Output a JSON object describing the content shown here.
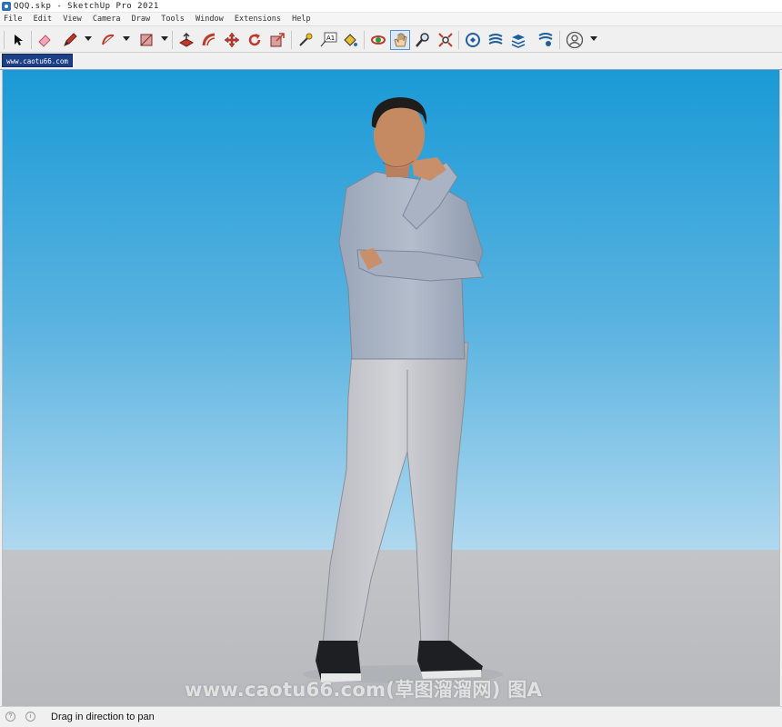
{
  "window": {
    "title": "QQQ.skp - SketchUp Pro 2021"
  },
  "menu": {
    "items": [
      "File",
      "Edit",
      "View",
      "Camera",
      "Draw",
      "Tools",
      "Window",
      "Extensions",
      "Help"
    ]
  },
  "toolbar": {
    "tools": [
      {
        "name": "select-tool",
        "icon": "arrow-cursor-icon"
      },
      {
        "name": "eraser-tool",
        "icon": "eraser-icon"
      },
      {
        "name": "line-tool",
        "icon": "pencil-icon"
      },
      {
        "name": "arc-tool",
        "icon": "arc-icon"
      },
      {
        "name": "shape-tool",
        "icon": "rectangle-icon"
      },
      {
        "name": "push-pull-tool",
        "icon": "push-pull-icon"
      },
      {
        "name": "offset-tool",
        "icon": "offset-icon"
      },
      {
        "name": "move-tool",
        "icon": "move-icon"
      },
      {
        "name": "rotate-tool",
        "icon": "rotate-icon"
      },
      {
        "name": "scale-tool",
        "icon": "scale-icon"
      },
      {
        "name": "tape-measure-tool",
        "icon": "tape-measure-icon"
      },
      {
        "name": "text-tool",
        "icon": "text-icon",
        "label": "A1"
      },
      {
        "name": "paint-bucket-tool",
        "icon": "paint-bucket-icon"
      },
      {
        "name": "orbit-tool",
        "icon": "orbit-icon"
      },
      {
        "name": "pan-tool",
        "icon": "hand-icon",
        "active": true
      },
      {
        "name": "zoom-tool",
        "icon": "magnifier-icon"
      },
      {
        "name": "zoom-extents-tool",
        "icon": "zoom-extents-icon"
      },
      {
        "name": "3d-warehouse",
        "icon": "warehouse-icon"
      },
      {
        "name": "extension-warehouse",
        "icon": "extension-warehouse-icon"
      },
      {
        "name": "layout",
        "icon": "layout-icon"
      },
      {
        "name": "extension-manager",
        "icon": "extension-manager-icon"
      },
      {
        "name": "account",
        "icon": "user-icon"
      }
    ],
    "accent": "#c0392b",
    "active_highlight": "#5a8fd0"
  },
  "scene_tab": {
    "label": "www.caotu66.com"
  },
  "viewport": {
    "sky_top": "#1a9ad6",
    "sky_bottom": "#c6e5f5",
    "ground": "#c0c2c6",
    "watermark": "www.caotu66.com(草图溜溜网) 图A"
  },
  "statusbar": {
    "message": "Drag in direction to pan",
    "icons": [
      "geo-location-icon",
      "info-icon"
    ]
  }
}
